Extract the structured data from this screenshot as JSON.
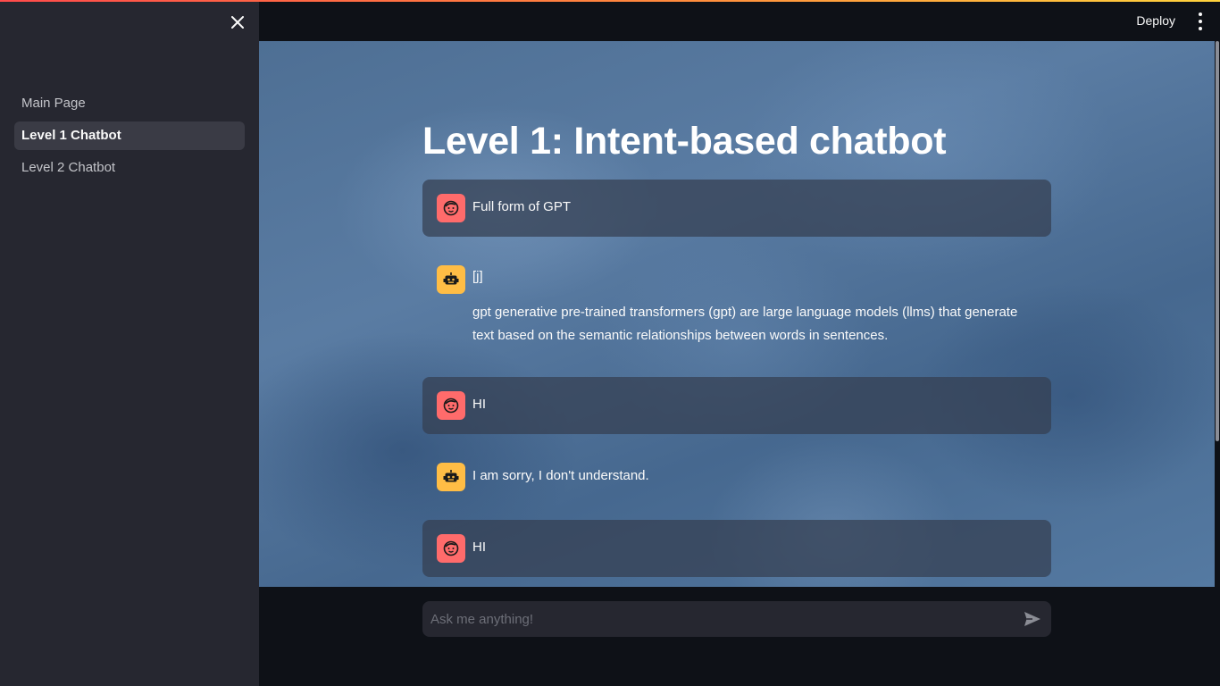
{
  "theme": {
    "accent_stripe": [
      "#ff4b4b",
      "#ffd33d"
    ],
    "user_avatar": "#ff6b6b",
    "bot_avatar": "#ffbd45"
  },
  "sidebar": {
    "close_icon": "close-icon",
    "items": [
      {
        "label": "Main Page",
        "active": false
      },
      {
        "label": "Level 1 Chatbot",
        "active": true
      },
      {
        "label": "Level 2 Chatbot",
        "active": false
      }
    ]
  },
  "header": {
    "deploy_label": "Deploy",
    "menu_icon": "kebab-menu-icon"
  },
  "main": {
    "title": "Level 1: Intent-based chatbot",
    "messages": [
      {
        "role": "user",
        "icon": "user-face-icon",
        "text": "Full form of GPT"
      },
      {
        "role": "assistant",
        "icon": "robot-icon",
        "text": "[j]",
        "text2": "gpt generative pre-trained transformers (gpt) are large language models (llms) that generate text based on the semantic relationships between words in sentences."
      },
      {
        "role": "user",
        "icon": "user-face-icon",
        "text": "HI"
      },
      {
        "role": "assistant",
        "icon": "robot-icon",
        "text": "I am sorry, I don't understand."
      },
      {
        "role": "user",
        "icon": "user-face-icon",
        "text": "HI"
      }
    ]
  },
  "chat_input": {
    "placeholder": "Ask me anything!",
    "value": "",
    "send_icon": "send-icon"
  }
}
